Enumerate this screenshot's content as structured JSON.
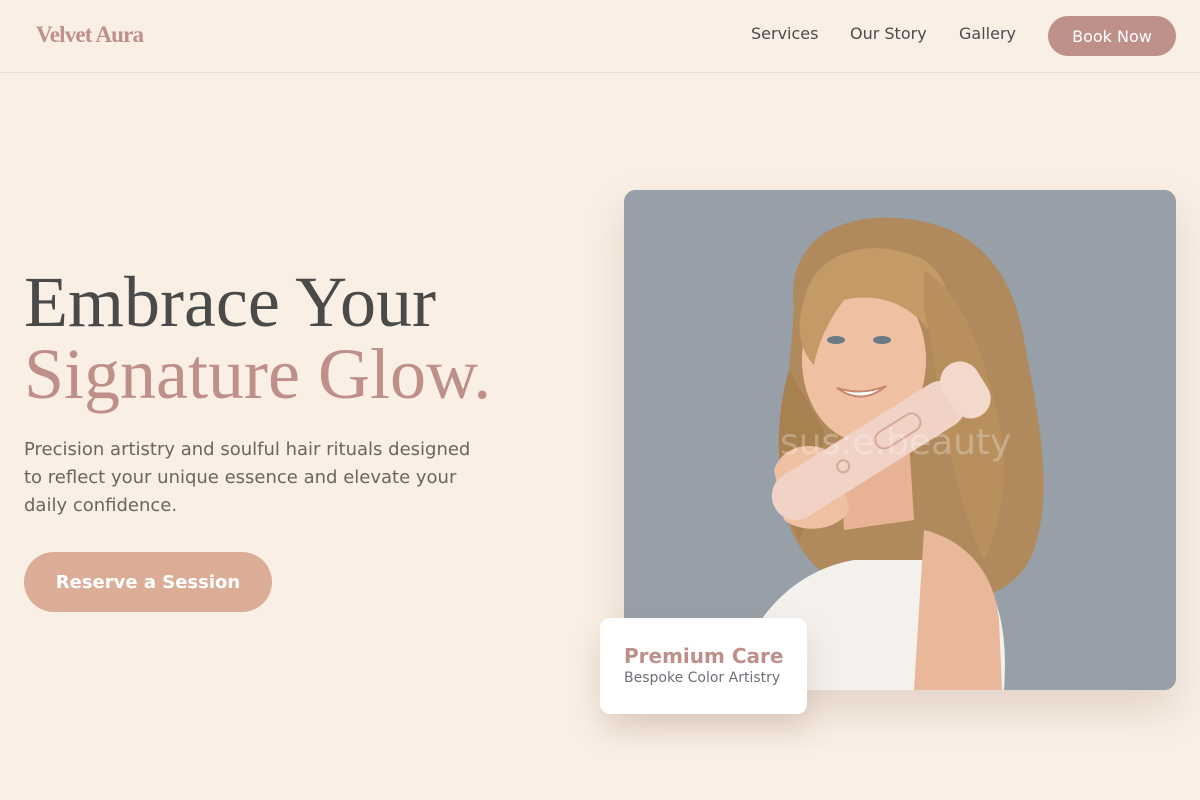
{
  "brand": {
    "name": "Velvet Aura"
  },
  "nav": {
    "links": [
      "Services",
      "Our Story",
      "Gallery"
    ],
    "book_label": "Book Now"
  },
  "hero": {
    "headline_line1": "Embrace Your",
    "headline_line2": "Signature Glow.",
    "description": "Precision artistry and soulful hair rituals designed to reflect your unique essence and elevate your daily confidence.",
    "cta_label": "Reserve a Session"
  },
  "image": {
    "watermark": "sus:e.beauty"
  },
  "badge": {
    "title": "Premium Care",
    "subtitle": "Bespoke Color Artistry"
  },
  "colors": {
    "background": "#faefe5",
    "accent_rose": "#bf8f8a",
    "accent_peach": "#dbad97",
    "text_dark": "#4a4a4a",
    "photo_bg": "#979fa8"
  },
  "icons": []
}
